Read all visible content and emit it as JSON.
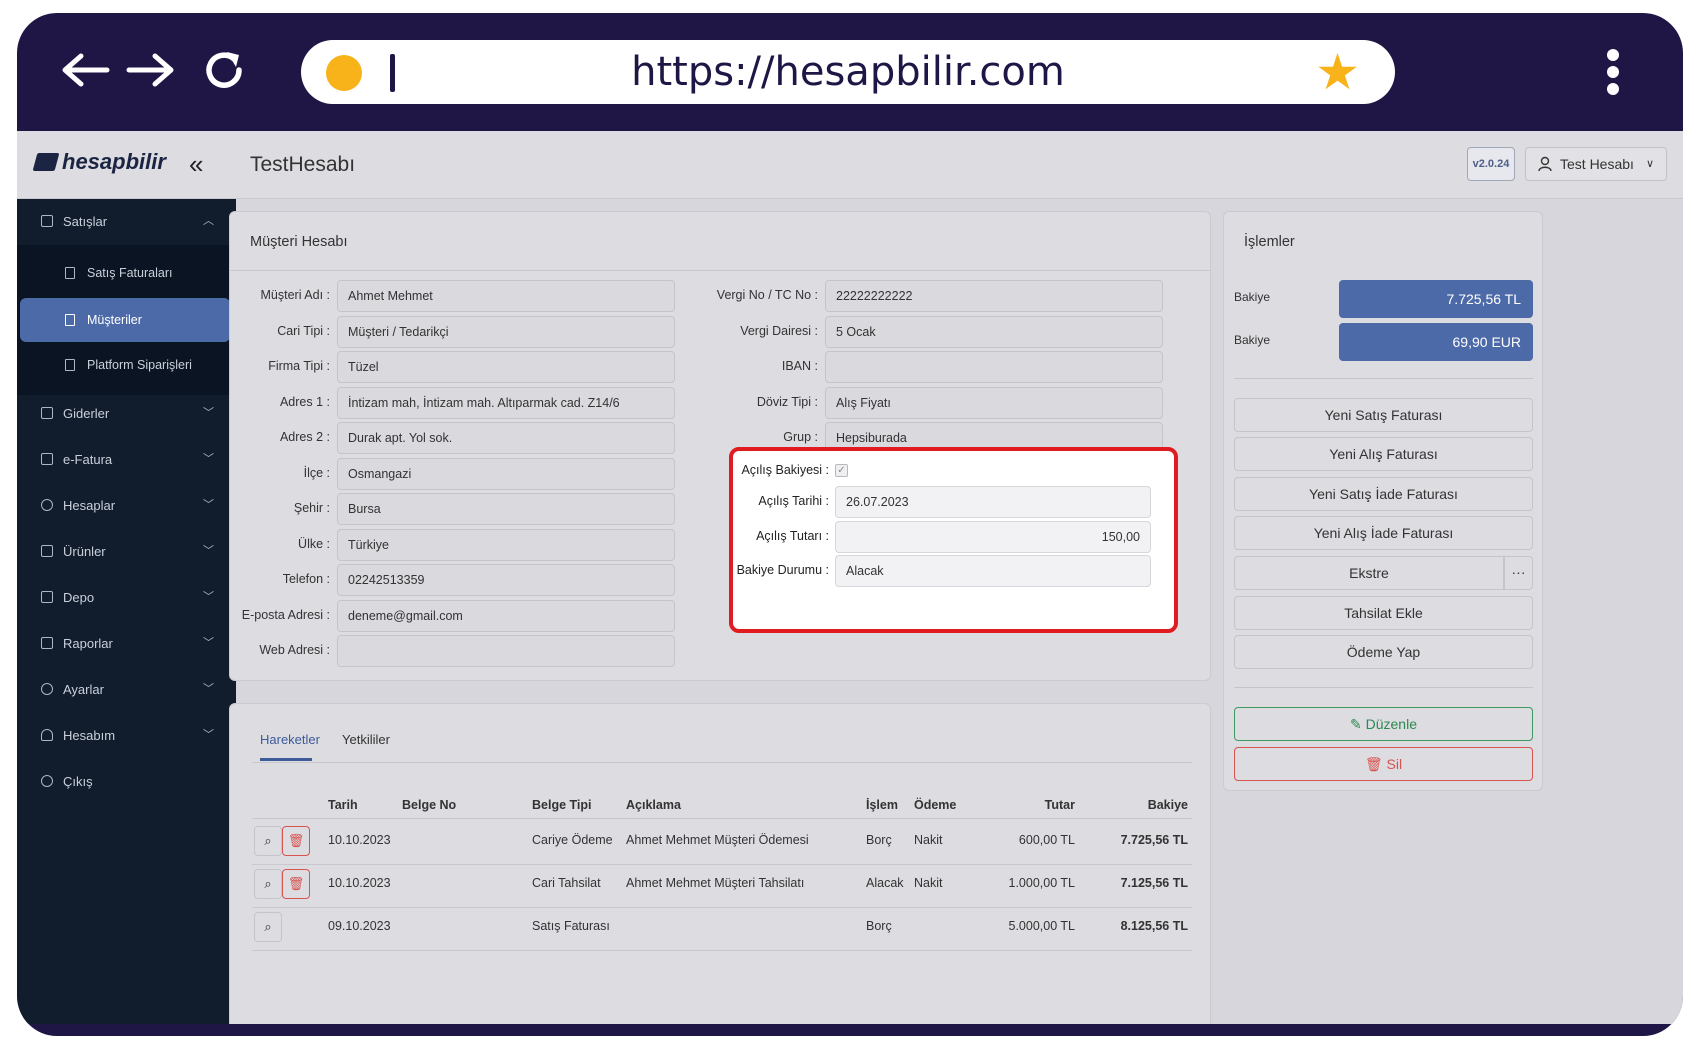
{
  "browser": {
    "url": "https://hesapbilir.com"
  },
  "app": {
    "logo": "hesapbilir",
    "page_title": "TestHesabı",
    "version": "v2.0.24",
    "user": "Test Hesabı"
  },
  "sidebar": {
    "sales": "Satışlar",
    "sub": [
      "Satış Faturaları",
      "Müşteriler",
      "Platform Siparişleri"
    ],
    "items": [
      "Giderler",
      "e-Fatura",
      "Hesaplar",
      "Ürünler",
      "Depo",
      "Raporlar",
      "Ayarlar",
      "Hesabım",
      "Çıkış"
    ]
  },
  "customer": {
    "title": "Müşteri Hesabı",
    "left": [
      {
        "label": "Müşteri Adı :",
        "value": "Ahmet Mehmet"
      },
      {
        "label": "Cari Tipi :",
        "value": "Müşteri / Tedarikçi"
      },
      {
        "label": "Firma Tipi :",
        "value": "Tüzel"
      },
      {
        "label": "Adres 1 :",
        "value": "İntizam mah, İntizam mah. Altıparmak cad. Z14/6"
      },
      {
        "label": "Adres 2 :",
        "value": "Durak apt. Yol sok."
      },
      {
        "label": "İlçe :",
        "value": "Osmangazi"
      },
      {
        "label": "Şehir :",
        "value": "Bursa"
      },
      {
        "label": "Ülke :",
        "value": "Türkiye"
      },
      {
        "label": "Telefon :",
        "value": "02242513359"
      },
      {
        "label": "E-posta Adresi :",
        "value": "deneme@gmail.com"
      },
      {
        "label": "Web Adresi :",
        "value": ""
      }
    ],
    "right": [
      {
        "label": "Vergi No / TC No :",
        "value": "22222222222"
      },
      {
        "label": "Vergi Dairesi :",
        "value": "5 Ocak"
      },
      {
        "label": "IBAN :",
        "value": ""
      },
      {
        "label": "Döviz Tipi :",
        "value": "Alış Fiyatı"
      },
      {
        "label": "Grup :",
        "value": "Hepsiburada"
      }
    ],
    "opening": {
      "balance_label": "Açılış Bakiyesi :",
      "balance_checked": true,
      "date_label": "Açılış Tarihi :",
      "date": "26.07.2023",
      "amount_label": "Açılış Tutarı :",
      "amount": "150,00",
      "status_label": "Bakiye Durumu :",
      "status": "Alacak"
    }
  },
  "actions": {
    "title": "İşlemler",
    "balances": [
      {
        "label": "Bakiye",
        "value": "7.725,56 TL"
      },
      {
        "label": "Bakiye",
        "value": "69,90 EUR"
      }
    ],
    "buttons": [
      "Yeni Satış Faturası",
      "Yeni Alış Faturası",
      "Yeni Satış İade Faturası",
      "Yeni Alış İade Faturası",
      "Ekstre",
      "Tahsilat Ekle",
      "Ödeme Yap"
    ],
    "more": "···",
    "edit": "Düzenle",
    "delete": "Sil"
  },
  "movements": {
    "tabs": [
      "Hareketler",
      "Yetkililer"
    ],
    "columns": [
      "Tarih",
      "Belge No",
      "Belge Tipi",
      "Açıklama",
      "İşlem",
      "Ödeme",
      "Tutar",
      "Bakiye"
    ],
    "rows": [
      {
        "date": "10.10.2023",
        "doc_no": "",
        "doc_type": "Cariye Ödeme",
        "desc": "Ahmet Mehmet Müşteri Ödemesi",
        "op": "Borç",
        "pay": "Nakit",
        "amount": "600,00 TL",
        "balance": "7.725,56 TL"
      },
      {
        "date": "10.10.2023",
        "doc_no": "",
        "doc_type": "Cari Tahsilat",
        "desc": "Ahmet Mehmet Müşteri Tahsilatı",
        "op": "Alacak",
        "pay": "Nakit",
        "amount": "1.000,00 TL",
        "balance": "7.125,56 TL"
      },
      {
        "date": "09.10.2023",
        "doc_no": "",
        "doc_type": "Satış Faturası",
        "desc": "",
        "op": "Borç",
        "pay": "",
        "amount": "5.000,00 TL",
        "balance": "8.125,56 TL"
      }
    ]
  },
  "colors": {
    "frame": "#1f1646",
    "accent": "#4d6aa8",
    "highlight": "#e11b22",
    "sidebar": "#111c2d"
  }
}
